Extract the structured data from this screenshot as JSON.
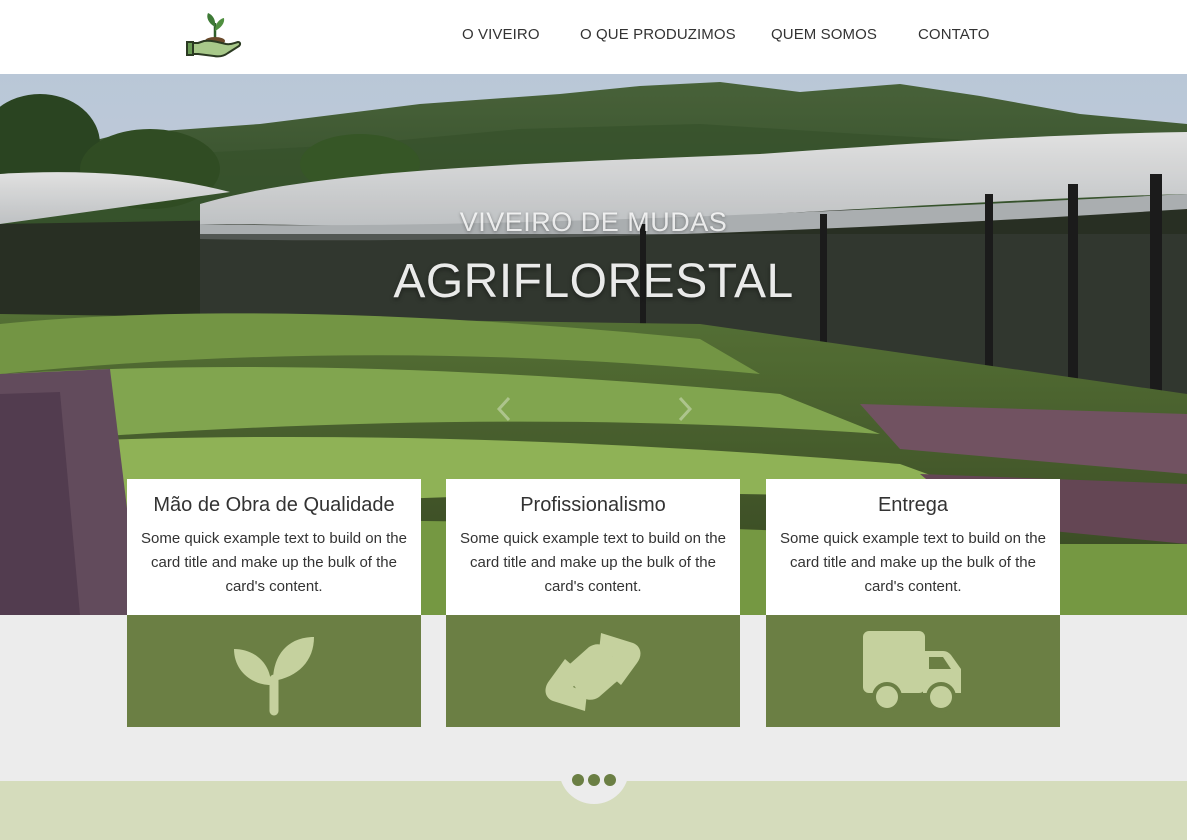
{
  "brand": {
    "logo_icon": "hand-sprout-icon"
  },
  "nav": {
    "items": [
      {
        "label": "O VIVEIRO"
      },
      {
        "label": "O QUE PRODUZIMOS"
      },
      {
        "label": "QUEM SOMOS"
      },
      {
        "label": "CONTATO"
      }
    ]
  },
  "hero": {
    "subtitle": "VIVEIRO DE MUDAS",
    "title": "AGRIFLORESTAL",
    "prev_icon": "chevron-left-icon",
    "next_icon": "chevron-right-icon"
  },
  "cards": [
    {
      "title": "Mão de Obra de Qualidade",
      "text": "Some quick example text to build on the card title and make up the bulk of the card's content.",
      "icon": "seedling-icon"
    },
    {
      "title": "Profissionalismo",
      "text": "Some quick example text to build on the card title and make up the bulk of the card's content.",
      "icon": "handshake-icon"
    },
    {
      "title": "Entrega",
      "text": "Some quick example text to build on the card title and make up the bulk of the card's content.",
      "icon": "truck-icon"
    }
  ],
  "more": {
    "icon": "ellipsis-icon"
  },
  "colors": {
    "accent_green": "#6b7f44",
    "light_green_band": "#d5dcbc",
    "page_gray": "#ececec"
  }
}
